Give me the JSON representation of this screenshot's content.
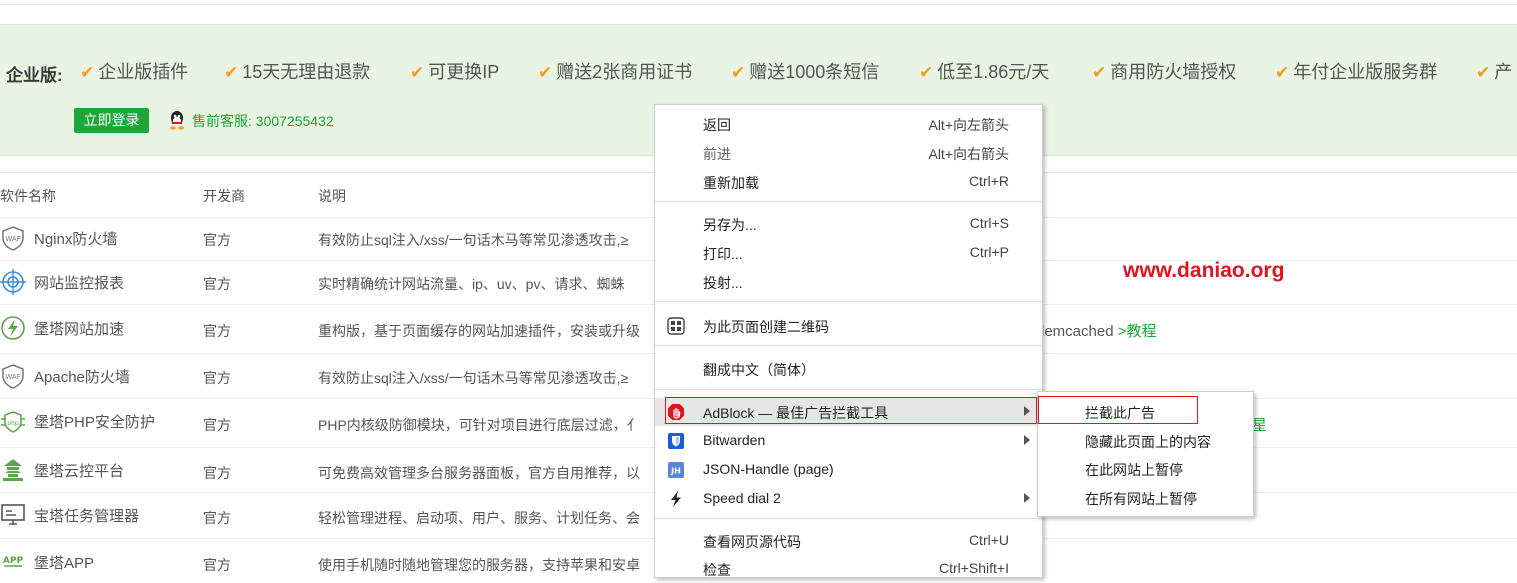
{
  "banner": {
    "title": "企业版:",
    "features": [
      "企业版插件",
      "15天无理由退款",
      "可更换IP",
      "赠送2张商用证书",
      "赠送1000条短信",
      "低至1.86元/天",
      "商用防火墙授权",
      "年付企业版服务群",
      "产"
    ],
    "login_button": "立即登录",
    "service": "售前客服: 3007255432",
    "accent_color": "#20a53a",
    "check_color": "#f29b1c"
  },
  "table": {
    "headers": [
      "软件名称",
      "开发商",
      "说明"
    ],
    "rows": [
      {
        "name": "Nginx防火墙",
        "dev": "官方",
        "desc": "有效防止sql注入/xss/一句话木马等常见渗透攻击,≥",
        "icon": "waf-icon"
      },
      {
        "name": "网站监控报表",
        "dev": "官方",
        "desc": "实时精确统计网站流量、ip、uv、pv、请求、蜘蛛",
        "icon": "target-icon"
      },
      {
        "name": "堡塔网站加速",
        "dev": "官方",
        "desc": "重构版，基于页面缓存的网站加速插件，安装或升级",
        "icon": "lightning-icon"
      },
      {
        "name": "Apache防火墙",
        "dev": "官方",
        "desc": "有效防止sql注入/xss/一句话木马等常见渗透攻击,≥",
        "icon": "waf-icon"
      },
      {
        "name": "堡塔PHP安全防护",
        "dev": "官方",
        "desc": "PHP内核级防御模块，可针对项目进行底层过滤，亻",
        "icon": "php-shield-icon"
      },
      {
        "name": "堡塔云控平台",
        "dev": "官方",
        "desc": "可免费高效管理多台服务器面板，官方自用推荐，以",
        "icon": "tower-icon"
      },
      {
        "name": "宝塔任务管理器",
        "dev": "官方",
        "desc": "轻松管理进程、启动项、用户、服务、计划任务、会",
        "icon": "monitor-icon"
      },
      {
        "name": "堡塔APP",
        "dev": "官方",
        "desc": "使用手机随时随地管理您的服务器，支持苹果和安卓",
        "icon": "app-icon"
      }
    ],
    "extra_row3": "lemcached",
    "extra_row3_link": ">教程",
    "extra_row5": "星"
  },
  "watermark": "www.daniao.org",
  "context_menu": {
    "items": [
      {
        "label": "返回",
        "shortcut": "Alt+向左箭头"
      },
      {
        "label": "前进",
        "shortcut": "Alt+向右箭头"
      },
      {
        "label": "重新加载",
        "shortcut": "Ctrl+R"
      },
      {
        "label": "另存为...",
        "shortcut": "Ctrl+S"
      },
      {
        "label": "打印...",
        "shortcut": "Ctrl+P"
      },
      {
        "label": "投射..."
      },
      {
        "label": "为此页面创建二维码",
        "icon": "qr-code-icon"
      },
      {
        "label": "翻成中文（简体）"
      },
      {
        "label": "AdBlock — 最佳广告拦截工具",
        "icon": "adblock-hand-icon"
      },
      {
        "label": "Bitwarden",
        "icon": "bitwarden-shield-icon"
      },
      {
        "label": "JSON-Handle (page)",
        "icon": "jh-icon"
      },
      {
        "label": "Speed dial 2",
        "icon": "lightning-icon"
      },
      {
        "label": "查看网页源代码",
        "shortcut": "Ctrl+U"
      },
      {
        "label": "检查",
        "shortcut": "Ctrl+Shift+I"
      }
    ]
  },
  "submenu": {
    "items": [
      "拦截此广告",
      "隐藏此页面上的内容",
      "在此网站上暂停",
      "在所有网站上暂停"
    ]
  }
}
